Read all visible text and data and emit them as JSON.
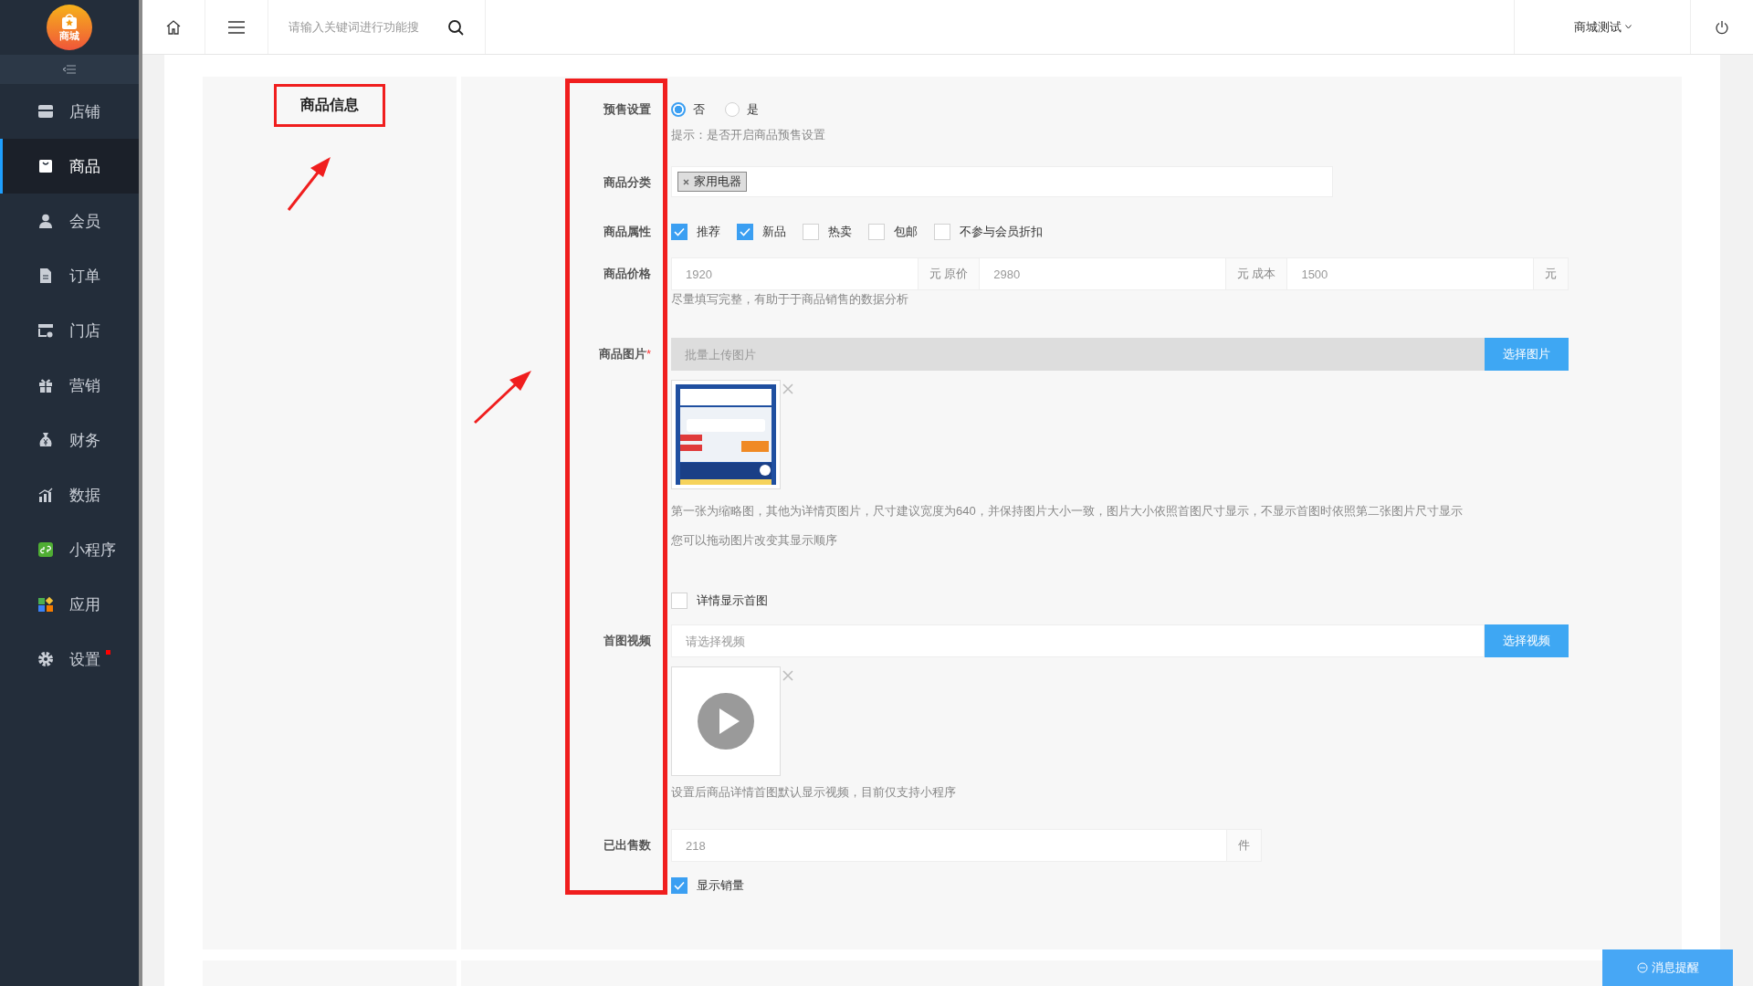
{
  "logo": {
    "label": "商城"
  },
  "sidebar": {
    "items": [
      {
        "label": "店铺",
        "selected": false,
        "dot": false
      },
      {
        "label": "商品",
        "selected": true,
        "dot": false
      },
      {
        "label": "会员",
        "selected": false,
        "dot": false
      },
      {
        "label": "订单",
        "selected": false,
        "dot": false
      },
      {
        "label": "门店",
        "selected": false,
        "dot": false
      },
      {
        "label": "营销",
        "selected": false,
        "dot": false
      },
      {
        "label": "财务",
        "selected": false,
        "dot": false
      },
      {
        "label": "数据",
        "selected": false,
        "dot": false
      },
      {
        "label": "小程序",
        "selected": false,
        "dot": false
      },
      {
        "label": "应用",
        "selected": false,
        "dot": false
      },
      {
        "label": "设置",
        "selected": false,
        "dot": true
      }
    ]
  },
  "topbar": {
    "search": {
      "placeholder": "请输入关键词进行功能搜"
    },
    "store": "商城测试"
  },
  "section": {
    "title": "商品信息"
  },
  "form": {
    "presale": {
      "label": "预售设置",
      "options": [
        {
          "label": "否",
          "selected": true
        },
        {
          "label": "是",
          "selected": false
        }
      ],
      "hint": "提示：是否开启商品预售设置"
    },
    "category": {
      "label": "商品分类",
      "tags": [
        "家用电器"
      ]
    },
    "attributes": {
      "label": "商品属性",
      "options": [
        {
          "label": "推荐",
          "checked": true
        },
        {
          "label": "新品",
          "checked": true
        },
        {
          "label": "热卖",
          "checked": false
        },
        {
          "label": "包邮",
          "checked": false
        },
        {
          "label": "不参与会员折扣",
          "checked": false
        }
      ]
    },
    "price": {
      "label": "商品价格",
      "fields": [
        {
          "value": "1920",
          "unit": "元 原价"
        },
        {
          "value": "2980",
          "unit": "元 成本"
        },
        {
          "value": "1500",
          "unit": "元"
        }
      ],
      "hint": "尽量填写完整，有助于于商品销售的数据分析"
    },
    "images": {
      "label": "商品图片",
      "required_mark": "*",
      "placeholder": "批量上传图片",
      "button": "选择图片",
      "items": [
        {
          "kind": "picture"
        }
      ],
      "hints": [
        "第一张为缩略图，其他为详情页图片，尺寸建议宽度为640，并保持图片大小一致，图片大小依照首图尺寸显示，不显示首图时依照第二张图片尺寸显示",
        "您可以拖动图片改变其显示顺序"
      ]
    },
    "detail_first_image": {
      "label": "详情显示首图",
      "checked": false
    },
    "video": {
      "label": "首图视频",
      "placeholder": "请选择视频",
      "button": "选择视频",
      "hint": "设置后商品详情首图默认显示视频，目前仅支持小程序"
    },
    "sales": {
      "label": "已出售数",
      "value": "218",
      "unit": "件"
    },
    "show_sales": {
      "label": "显示销量",
      "checked": true
    }
  },
  "message_button": "消息提醒"
}
